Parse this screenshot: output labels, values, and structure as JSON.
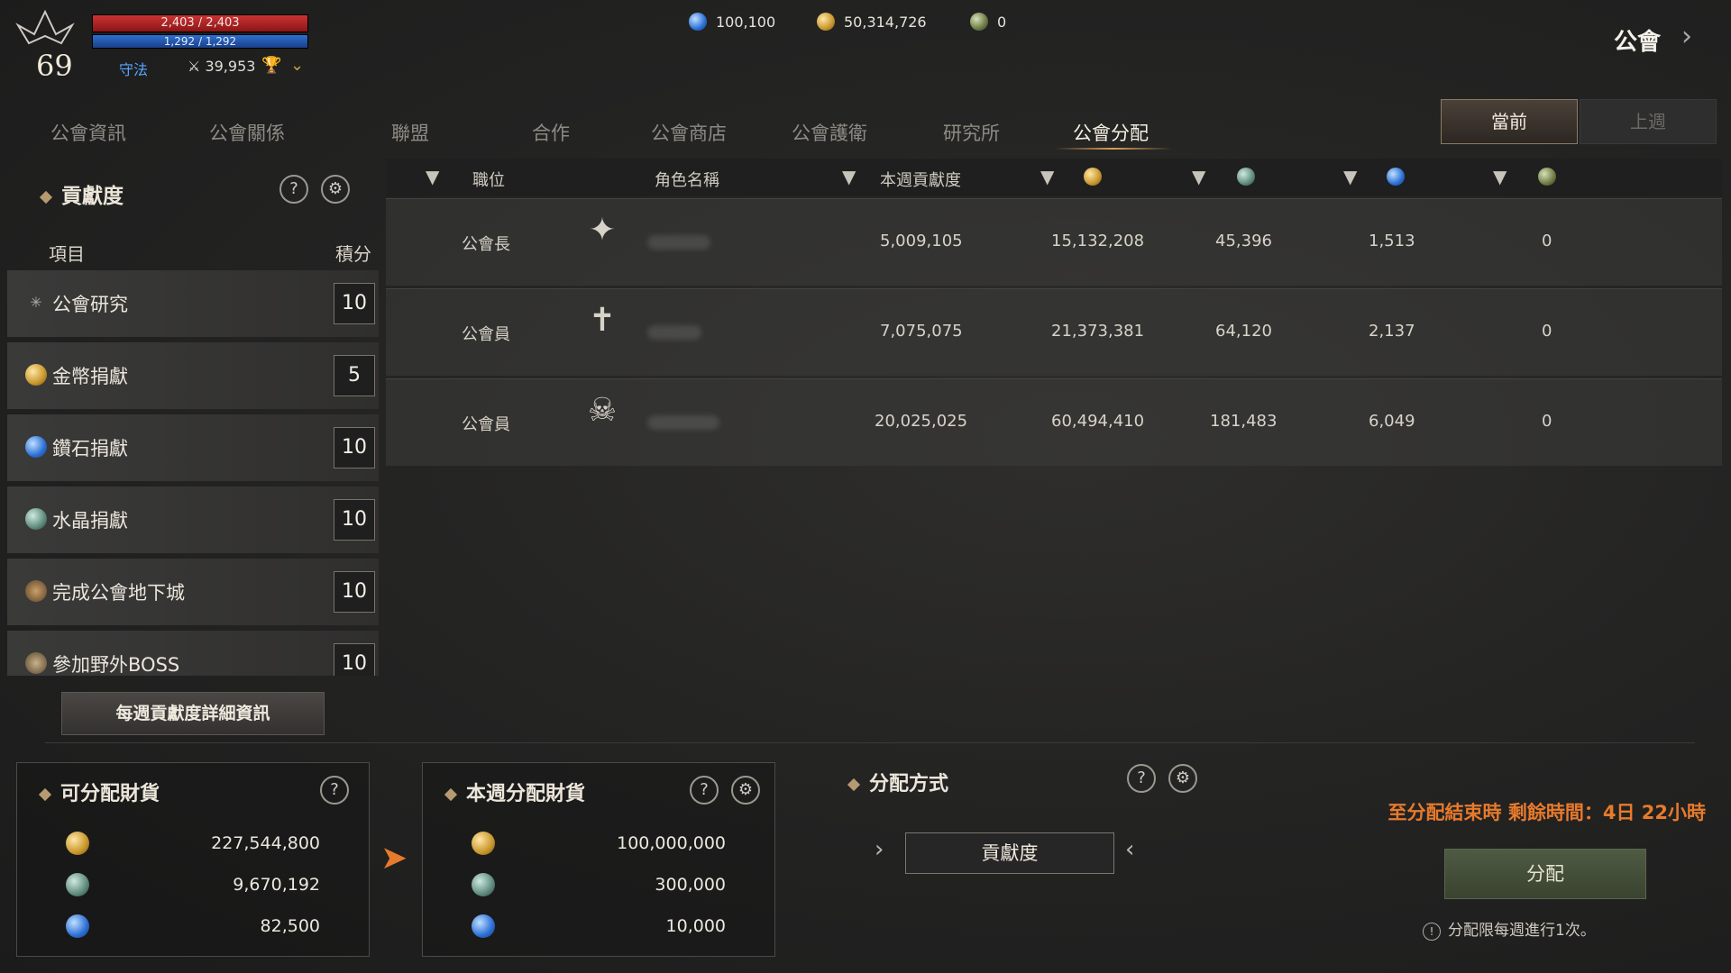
{
  "hud": {
    "hp": "2,403 / 2,403",
    "mp": "1,292 / 1,292",
    "level": "69",
    "class_name": "守法",
    "power": "39,953"
  },
  "currencies": [
    {
      "icon": "diamond-icon",
      "value": "100,100"
    },
    {
      "icon": "gold-coin-icon",
      "value": "50,314,726"
    },
    {
      "icon": "guild-coin-icon",
      "value": "0"
    }
  ],
  "page_title": "公會",
  "tabs": [
    "公會資訊",
    "公會關係",
    "聯盟",
    "合作",
    "公會商店",
    "公會護衛",
    "研究所",
    "公會分配"
  ],
  "active_tab": "公會分配",
  "period_buttons": {
    "current": "當前",
    "last": "上週"
  },
  "left_panel": {
    "title": "貢獻度",
    "col_item": "項目",
    "col_score": "積分",
    "items": [
      {
        "name": "公會研究",
        "score": "10",
        "icon": "research-icon"
      },
      {
        "name": "金幣捐獻",
        "score": "5",
        "icon": "gold-coin-icon"
      },
      {
        "name": "鑽石捐獻",
        "score": "10",
        "icon": "diamond-icon"
      },
      {
        "name": "水晶捐獻",
        "score": "10",
        "icon": "crystal-icon"
      },
      {
        "name": "完成公會地下城",
        "score": "10",
        "icon": "dungeon-icon"
      },
      {
        "name": "參加野外BOSS",
        "score": "10",
        "icon": "boss-icon"
      }
    ],
    "detail_button": "每週貢獻度詳細資訊"
  },
  "table": {
    "headers": {
      "role": "職位",
      "name": "角色名稱",
      "contribution": "本週貢獻度"
    },
    "rows": [
      {
        "role": "公會長",
        "contribution": "5,009,105",
        "gold": "15,132,208",
        "crystal": "45,396",
        "diamond": "1,513",
        "other": "0"
      },
      {
        "role": "公會員",
        "contribution": "7,075,075",
        "gold": "21,373,381",
        "crystal": "64,120",
        "diamond": "2,137",
        "other": "0"
      },
      {
        "role": "公會員",
        "contribution": "20,025,025",
        "gold": "60,494,410",
        "crystal": "181,483",
        "diamond": "6,049",
        "other": "0"
      }
    ]
  },
  "distributable": {
    "title": "可分配財貨",
    "values": [
      "227,544,800",
      "9,670,192",
      "82,500"
    ]
  },
  "weekly_distribution": {
    "title": "本週分配財貨",
    "values": [
      "100,000,000",
      "300,000",
      "10,000"
    ]
  },
  "method": {
    "title": "分配方式",
    "value": "貢獻度"
  },
  "timer_text": "至分配結束時 剩餘時間：4日 22小時",
  "distribute_button": "分配",
  "note": "分配限每週進行1次。",
  "colors": {
    "accent": "#e87a2c",
    "hp": "#c33333",
    "mp": "#2f6fd0"
  }
}
